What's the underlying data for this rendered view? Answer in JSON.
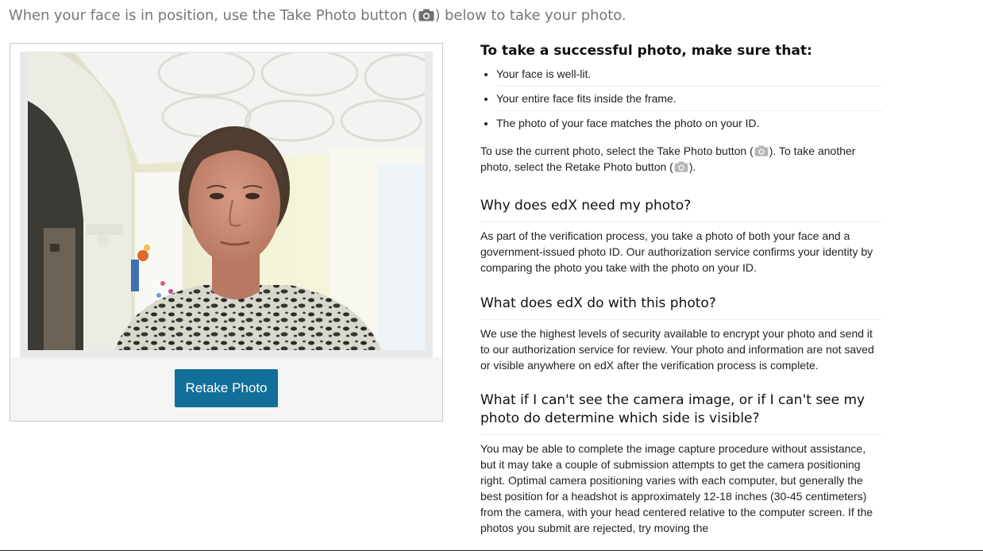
{
  "intro": {
    "before": "When your face is in position, use the Take Photo button (",
    "after": ") below to take your photo."
  },
  "photo": {
    "retake_label": "Retake Photo"
  },
  "help": {
    "checklist_title": "To take a successful photo, make sure that:",
    "checklist": [
      "Your face is well-lit.",
      "Your entire face fits inside the frame.",
      "The photo of your face matches the photo on your ID."
    ],
    "current_photo": {
      "part1": "To use the current photo, select the Take Photo button (",
      "part2": "). To take another photo, select the Retake Photo button (",
      "part3": ")."
    },
    "sections": [
      {
        "title": "Why does edX need my photo?",
        "body": "As part of the verification process, you take a photo of both your face and a government-issued photo ID. Our authorization service confirms your identity by comparing the photo you take with the photo on your ID."
      },
      {
        "title": "What does edX do with this photo?",
        "body": "We use the highest levels of security available to encrypt your photo and send it to our authorization service for review. Your photo and information are not saved or visible anywhere on edX after the verification process is complete."
      },
      {
        "title": "What if I can't see the camera image, or if I can't see my photo do determine which side is visible?",
        "body": "You may be able to complete the image capture procedure without assistance, but it may take a couple of submission attempts to get the camera positioning right. Optimal camera positioning varies with each computer, but generally the best position for a headshot is approximately 12-18 inches (30-45 centimeters) from the camera, with your head centered relative to the computer screen. If the photos you submit are rejected, try moving the"
      }
    ]
  },
  "icons": {
    "camera": "camera-icon"
  },
  "colors": {
    "button": "#126f9a",
    "intro_text": "#777777"
  }
}
